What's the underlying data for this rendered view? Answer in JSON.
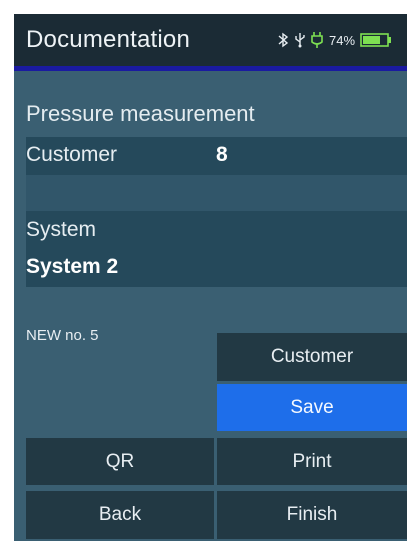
{
  "header": {
    "title": "Documentation",
    "battery_percent": "74%",
    "battery_level": 0.74,
    "icons": [
      "bluetooth-icon",
      "usb-icon",
      "plug-icon",
      "battery-icon"
    ]
  },
  "main": {
    "section_title": "Pressure measurement",
    "customer_label": "Customer",
    "customer_value": "8",
    "system_label": "System",
    "system_value": "System 2",
    "new_no": "NEW no. 5"
  },
  "buttons": {
    "customer": "Customer",
    "save": "Save",
    "qr": "QR",
    "print": "Print",
    "back": "Back",
    "finish": "Finish"
  },
  "colors": {
    "accent": "#1e6eea",
    "background": "#3a5f72",
    "header": "#1b2b35",
    "battery": "#7ee052"
  }
}
